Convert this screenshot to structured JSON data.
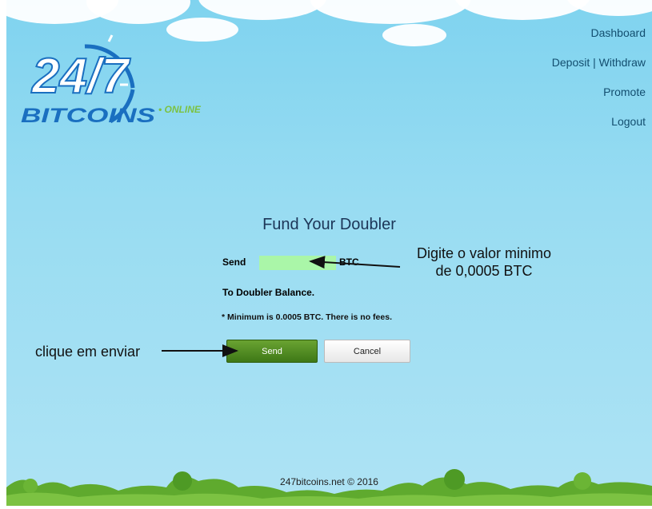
{
  "brand": {
    "logo_number": "24/7",
    "logo_word": "BITCOINS",
    "logo_suffix": "• ONLINE"
  },
  "nav": {
    "dashboard": "Dashboard",
    "deposit_withdraw": "Deposit | Withdraw",
    "promote": "Promote",
    "logout": "Logout"
  },
  "form": {
    "title": "Fund Your Doubler",
    "send_label": "Send",
    "amount_value": "",
    "currency": "BTC",
    "balance_label": "To Doubler Balance.",
    "note": "* Minimum is 0.0005 BTC. There is no fees.",
    "send_button": "Send",
    "cancel_button": "Cancel"
  },
  "annotations": {
    "amount_hint_line1": "Digite o valor minimo",
    "amount_hint_line2": "de 0,0005 BTC",
    "send_hint": "clique em enviar"
  },
  "footer": {
    "text": "247bitcoins.net © 2016"
  },
  "colors": {
    "sky": "#98dcf2",
    "input_bg": "#aaf6a8",
    "send_button": "#4f8a21",
    "logo_blue": "#1a6fc0",
    "logo_green": "#7cc242"
  }
}
